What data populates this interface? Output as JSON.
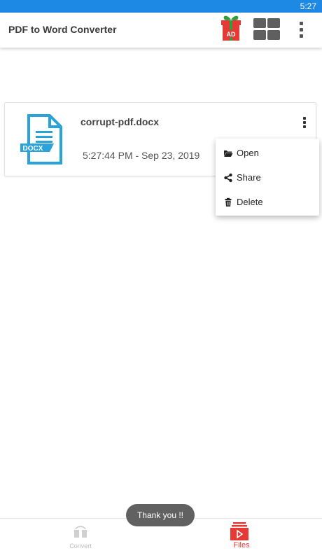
{
  "status_bar": {
    "time": "5:27",
    "color": "#1e88e5"
  },
  "app_bar": {
    "title": "PDF to Word Converter",
    "ad_badge": "AD",
    "icons": [
      "gift-ad-icon",
      "grid-view-icon",
      "more-vert-icon"
    ]
  },
  "file": {
    "name": "corrupt-pdf.docx",
    "date": "5:27:44 PM - Sep 23, 2019",
    "type_badge": "DOCX",
    "icon_color": "#2aa3d8"
  },
  "context_menu": {
    "items": [
      {
        "label": "Open",
        "icon": "folder-open-icon"
      },
      {
        "label": "Share",
        "icon": "share-icon"
      },
      {
        "label": "Delete",
        "icon": "trash-icon"
      }
    ]
  },
  "bottom_nav": {
    "tabs": [
      {
        "label": "Convert",
        "icon": "convert-icon",
        "active": false
      },
      {
        "label": "Files",
        "icon": "files-icon",
        "active": true
      }
    ],
    "active_color": "#e53935"
  },
  "toast": {
    "text": "Thank you !!"
  }
}
